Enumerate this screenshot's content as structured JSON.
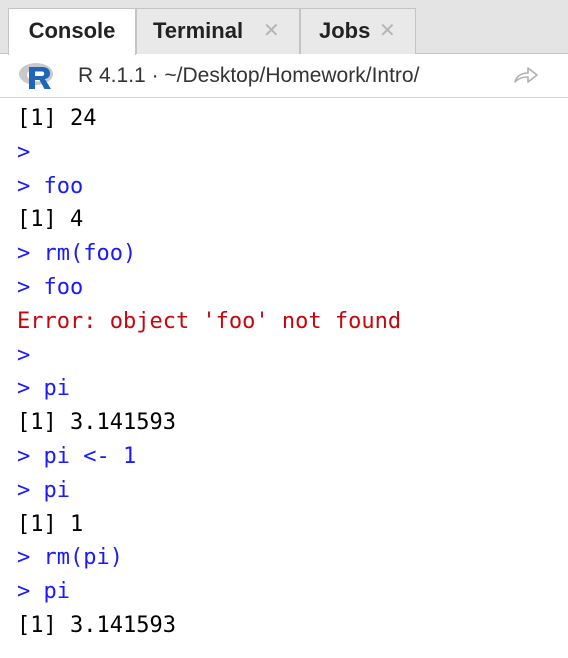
{
  "tabs": [
    {
      "label": "Console",
      "active": true,
      "closable": false
    },
    {
      "label": "Terminal",
      "active": false,
      "closable": true
    },
    {
      "label": "Jobs",
      "active": false,
      "closable": true
    }
  ],
  "toolbar": {
    "r_version": "R 4.1.1",
    "separator": "·",
    "path": "~/Desktop/Homework/Intro/",
    "icons": [
      "r-logo-icon",
      "goto-directory-icon"
    ]
  },
  "console": {
    "lines": [
      {
        "type": "output",
        "text": "[1] 24"
      },
      {
        "type": "input",
        "text": ">"
      },
      {
        "type": "input",
        "text": "> foo"
      },
      {
        "type": "output",
        "text": "[1] 4"
      },
      {
        "type": "input",
        "text": "> rm(foo)"
      },
      {
        "type": "input",
        "text": "> foo"
      },
      {
        "type": "error",
        "text": "Error: object 'foo' not found"
      },
      {
        "type": "input",
        "text": ">"
      },
      {
        "type": "input",
        "text": "> pi"
      },
      {
        "type": "output",
        "text": "[1] 3.141593"
      },
      {
        "type": "input",
        "text": "> pi <- 1"
      },
      {
        "type": "input",
        "text": "> pi"
      },
      {
        "type": "output",
        "text": "[1] 1"
      },
      {
        "type": "input",
        "text": "> rm(pi)"
      },
      {
        "type": "input",
        "text": "> pi"
      },
      {
        "type": "output",
        "text": "[1] 3.141593"
      }
    ]
  },
  "colors": {
    "input": "#1a1aff",
    "output": "#000000",
    "error": "#c5060b",
    "tabbar_bg": "#e4e4e4"
  }
}
